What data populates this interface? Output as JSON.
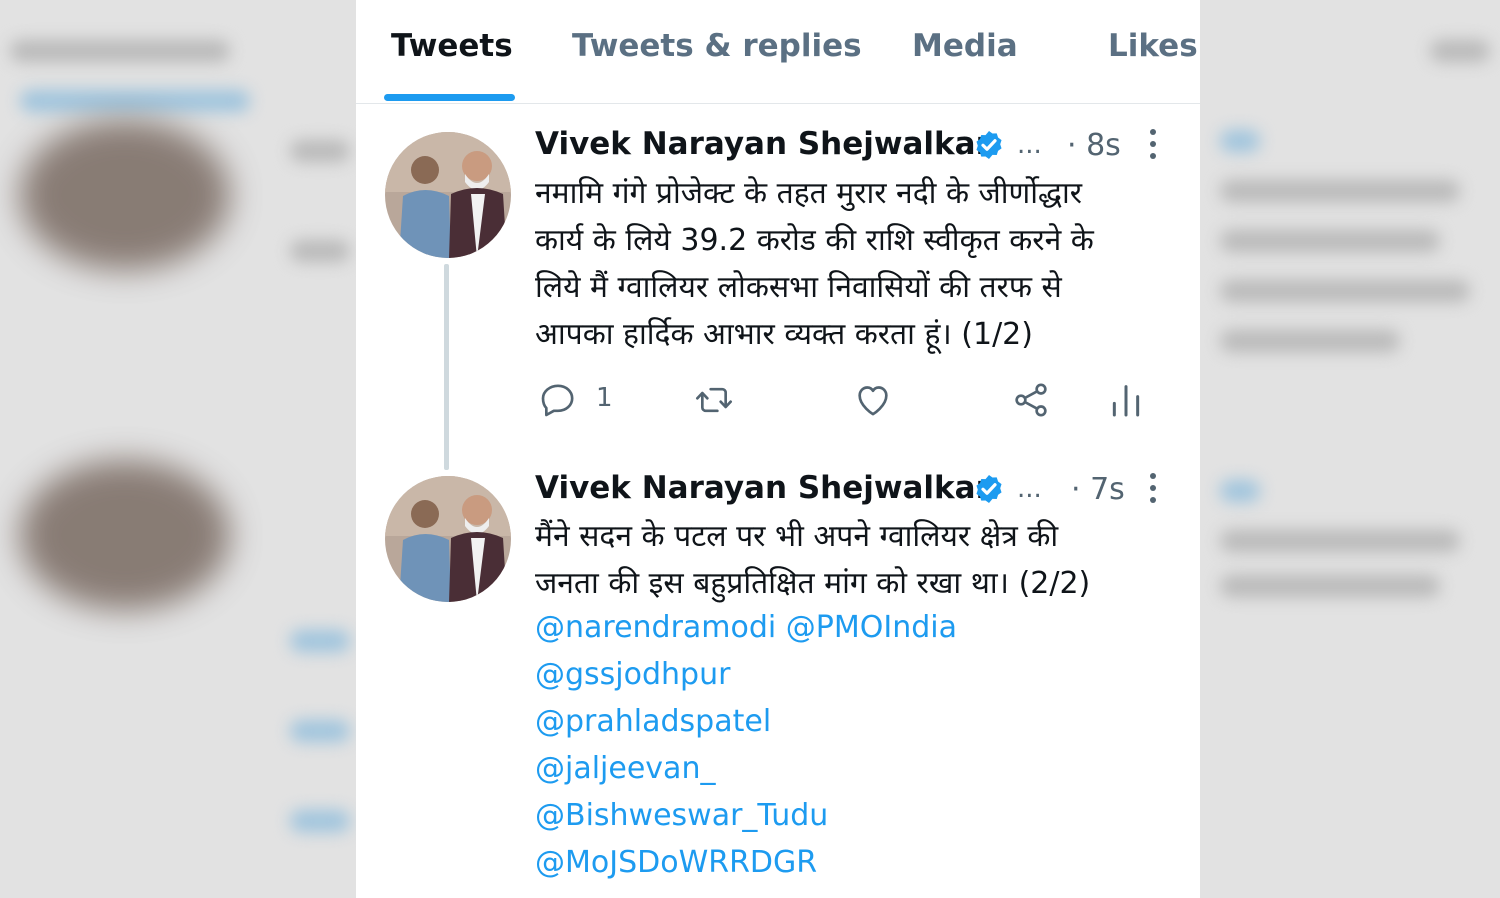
{
  "tabs": [
    {
      "label": "Tweets",
      "active": true
    },
    {
      "label": "Tweets & replies",
      "active": false
    },
    {
      "label": "Media",
      "active": false
    },
    {
      "label": "Likes",
      "active": false
    }
  ],
  "tweets": [
    {
      "author": "Vivek Narayan Shejwalkar",
      "handle": "...",
      "time": "· 8s",
      "lines": [
        "नमामि गंगे प्रोजेक्ट के तहत मुरार नदी के जीर्णोद्धार",
        "कार्य के लिये 39.2 करोड की राशि स्वीकृत करने के",
        "लिये मैं ग्वालियर लोकसभा निवासियों की तरफ से",
        "आपका हार्दिक आभार व्यक्त करता हूं। (1/2)"
      ],
      "reply_count": "1"
    },
    {
      "author": "Vivek Narayan Shejwalkar",
      "handle": "...",
      "time": "· 7s",
      "lines": [
        "मैंने सदन के पटल पर भी अपने ग्वालियर क्षेत्र की",
        "जनता की इस बहुप्रतिक्षित मांग को रखा था। (2/2)"
      ],
      "mention_lines": [
        "@narendramodi @PMOIndia",
        "@gssjodhpur",
        "@prahladspatel",
        "@jaljeevan_",
        "@Bishweswar_Tudu",
        "@MoJSDoWRRDGR"
      ]
    }
  ],
  "icons": {
    "reply": "reply-icon",
    "retweet": "retweet-icon",
    "like": "like-icon",
    "share": "share-icon",
    "analytics": "analytics-icon",
    "verified": "verified-badge-icon",
    "more": "more-icon"
  },
  "colors": {
    "accent": "#1d9bf0",
    "text": "#0f1419",
    "secondary": "#536471"
  }
}
